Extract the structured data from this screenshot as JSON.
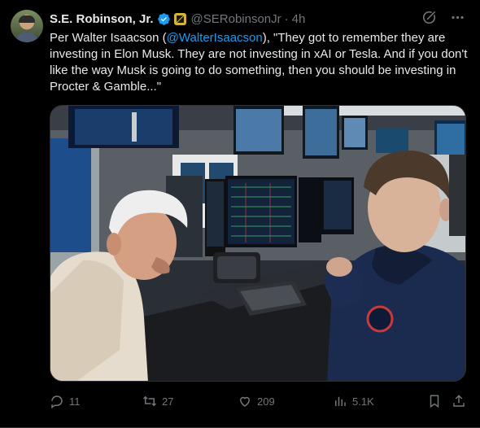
{
  "author": {
    "name": "S.E. Robinson, Jr.",
    "handle": "@SERobinsonJr",
    "separator": "·",
    "time": "4h"
  },
  "tweet": {
    "text_before": "Per Walter Isaacson (",
    "mention": "@WalterIsaacson",
    "text_after": "), \"They got to remember they are investing in Elon Musk. They are not investing in xAI or Tesla. And if you don't like the way Musk is going to do something, then you should be investing in Procter & Gamble...\""
  },
  "actions": {
    "replies": "11",
    "reposts": "27",
    "likes": "209",
    "views": "5.1K"
  },
  "icons": {
    "verified": "verified-badge-icon",
    "affiliation": "affiliation-badge-icon",
    "grok": "grok-icon",
    "more": "more-icon",
    "reply": "reply-icon",
    "repost": "repost-icon",
    "like": "heart-icon",
    "views": "views-icon",
    "bookmark": "bookmark-icon",
    "share": "share-icon"
  },
  "colors": {
    "background": "#000000",
    "text": "#e7e9ea",
    "muted": "#71767b",
    "accent": "#1d9bf0"
  }
}
